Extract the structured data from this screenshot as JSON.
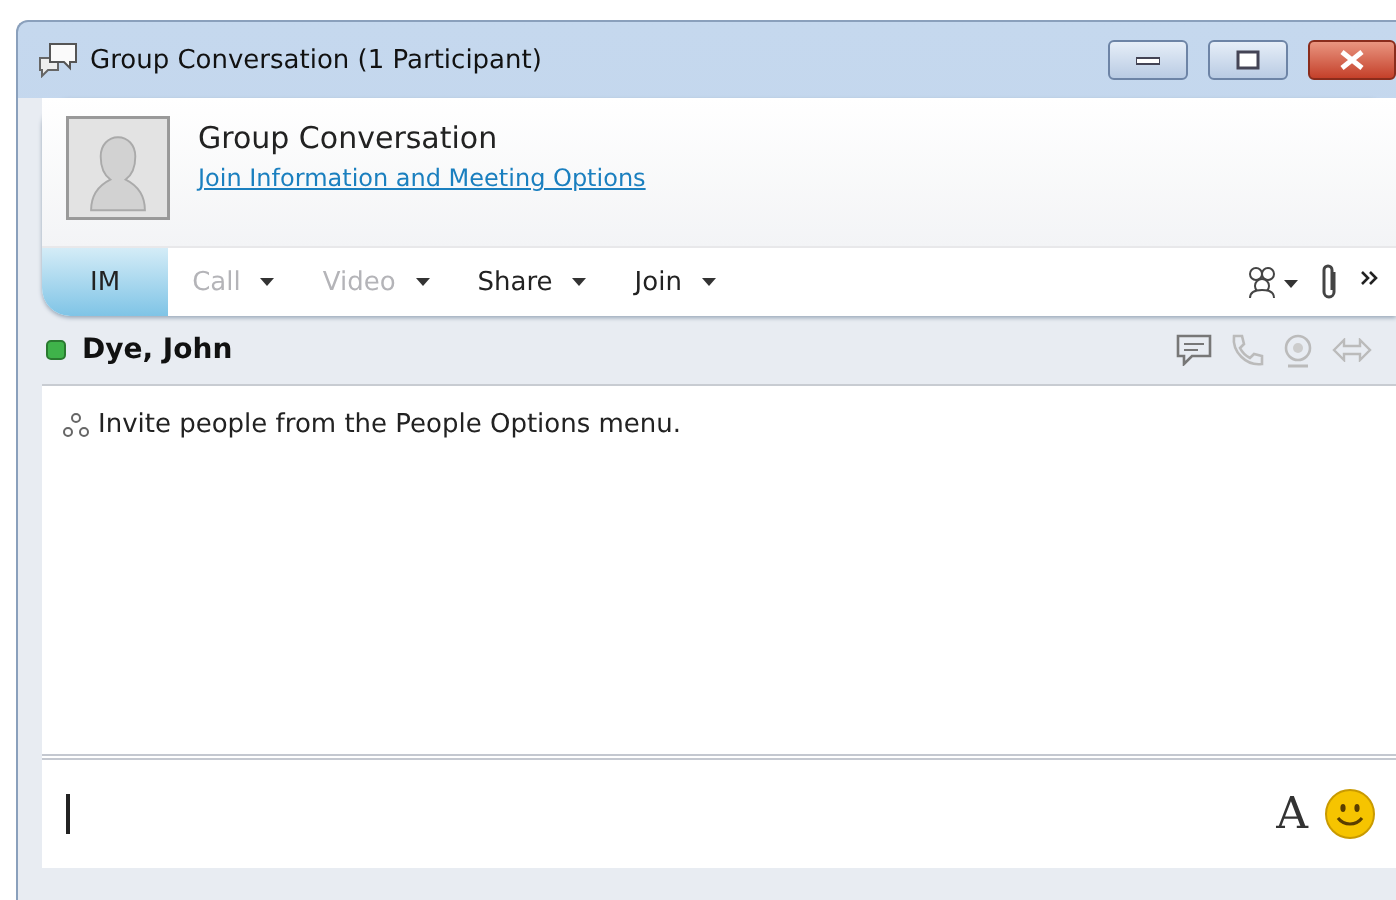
{
  "window": {
    "title": "Group Conversation (1 Participant)"
  },
  "header": {
    "title": "Group Conversation",
    "link": "Join Information and Meeting Options"
  },
  "toolbar": [
    {
      "label": "IM",
      "selected": true,
      "disabled": false,
      "dropdown": false
    },
    {
      "label": "Call",
      "selected": false,
      "disabled": true,
      "dropdown": true
    },
    {
      "label": "Video",
      "selected": false,
      "disabled": true,
      "dropdown": true
    },
    {
      "label": "Share",
      "selected": false,
      "disabled": false,
      "dropdown": true
    },
    {
      "label": "Join",
      "selected": false,
      "disabled": false,
      "dropdown": true
    }
  ],
  "participant": {
    "name": "Dye, John"
  },
  "messages": [
    {
      "text": "Invite people from the People Options menu."
    }
  ],
  "compose": {
    "font_button": "A"
  }
}
